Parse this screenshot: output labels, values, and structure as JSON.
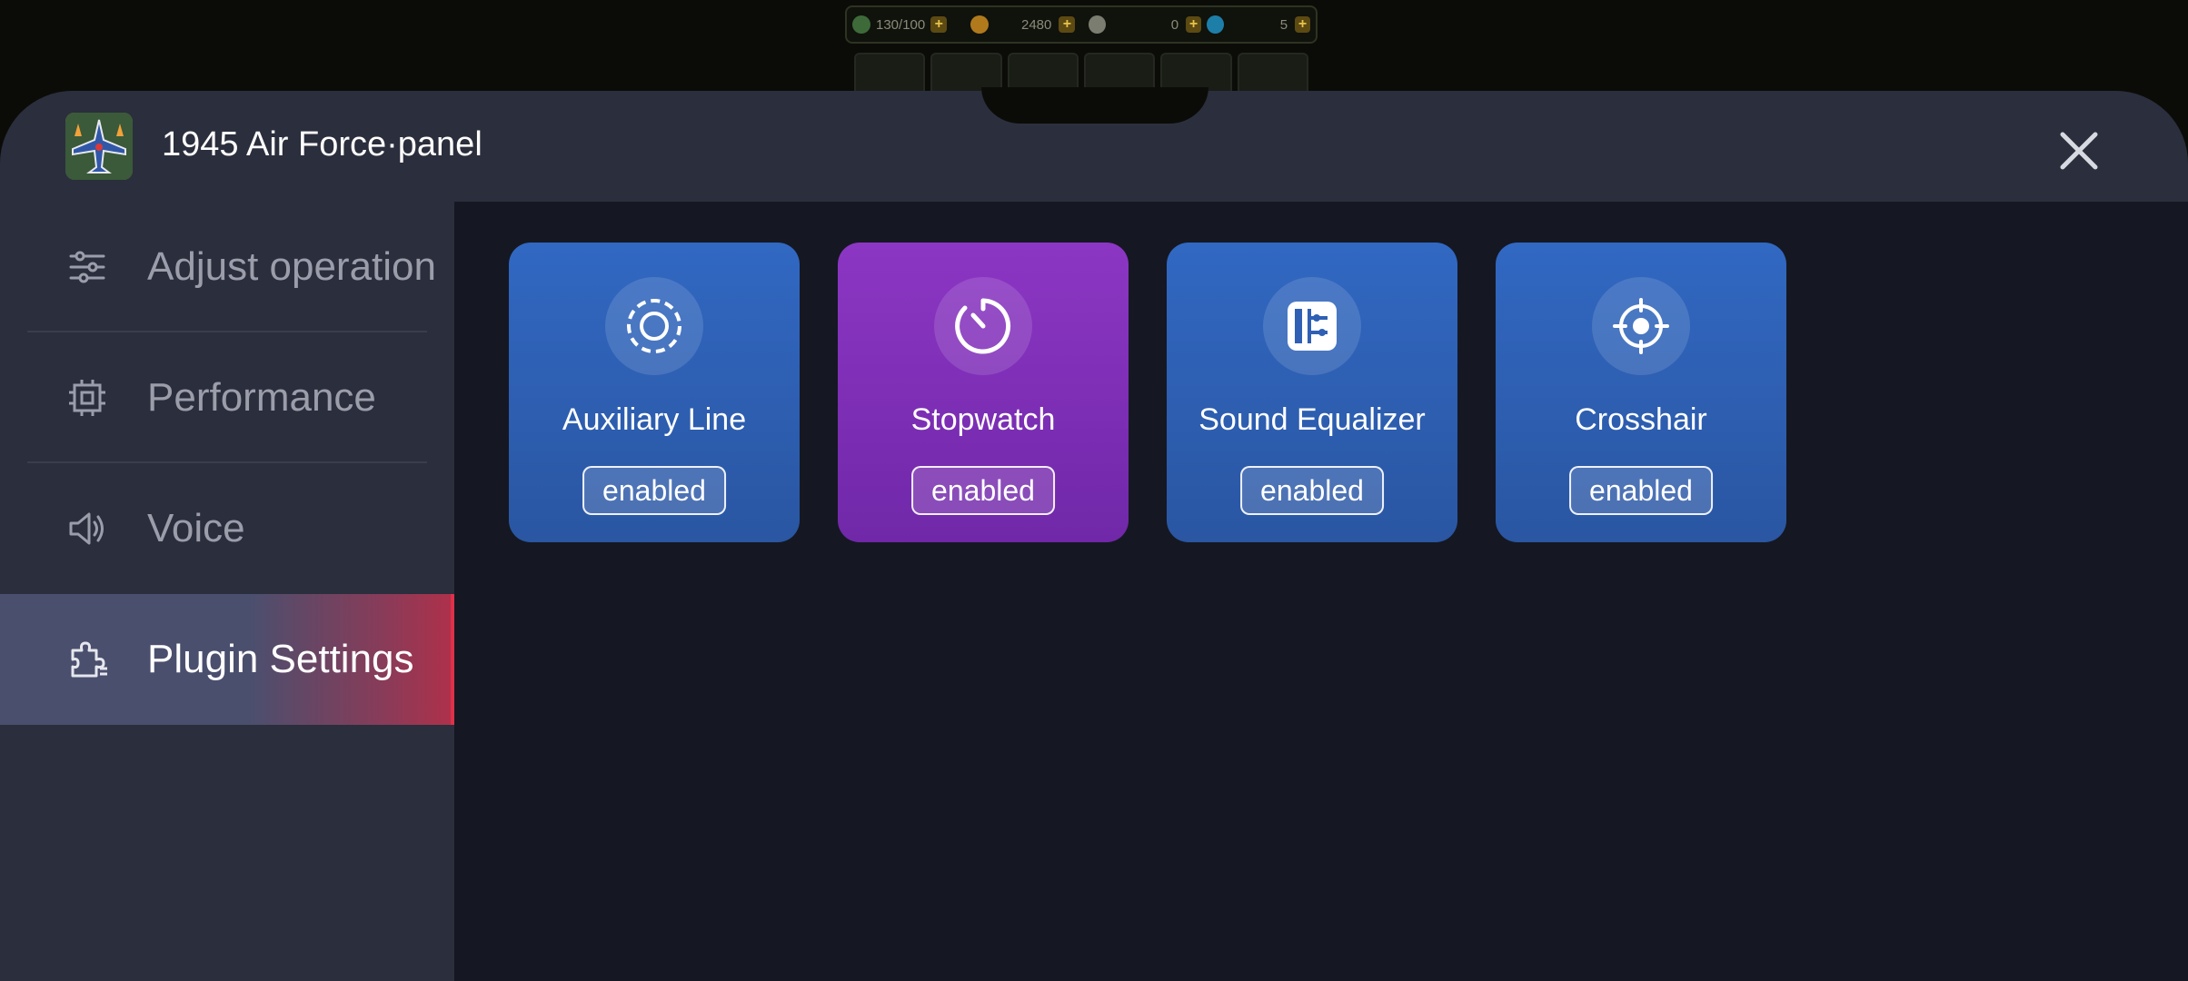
{
  "hud": {
    "energy": "130/100",
    "coins": "2480",
    "medals": "0",
    "gems": "5"
  },
  "header": {
    "title": "1945 Air Force·panel",
    "app_icon": "airplane-game-icon",
    "close_icon": "close-icon"
  },
  "sidebar": {
    "items": [
      {
        "label": "Adjust operation",
        "icon": "sliders-icon",
        "active": false
      },
      {
        "label": "Performance",
        "icon": "chip-icon",
        "active": false
      },
      {
        "label": "Voice",
        "icon": "speaker-icon",
        "active": false
      },
      {
        "label": "Plugin Settings",
        "icon": "puzzle-icon",
        "active": true
      }
    ]
  },
  "plugins": [
    {
      "label": "Auxiliary Line",
      "status": "enabled",
      "icon": "dashed-circle-icon",
      "color": "#3168c2"
    },
    {
      "label": "Stopwatch",
      "status": "enabled",
      "icon": "timer-icon",
      "color": "#8c36c4"
    },
    {
      "label": "Sound Equalizer",
      "status": "enabled",
      "icon": "equalizer-icon",
      "color": "#3168c2"
    },
    {
      "label": "Crosshair",
      "status": "enabled",
      "icon": "crosshair-icon",
      "color": "#3168c2"
    }
  ],
  "colors": {
    "accent_active": "#e0304a",
    "panel_bg": "#1d1f2a",
    "sidebar_bg": "#2b2e3c",
    "content_bg": "#151822"
  }
}
